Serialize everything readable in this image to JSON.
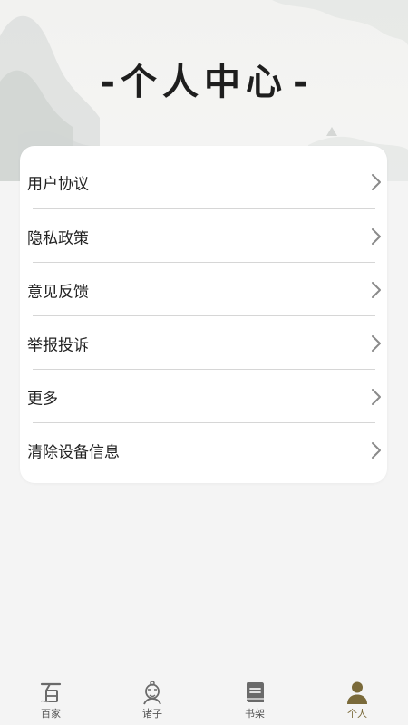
{
  "header": {
    "title": "个人中心",
    "dash_left": "-",
    "dash_right": "-"
  },
  "menu": {
    "items": [
      {
        "label": "用户协议",
        "icon": "chevron-right-icon"
      },
      {
        "label": "隐私政策",
        "icon": "chevron-right-icon"
      },
      {
        "label": "意见反馈",
        "icon": "chevron-right-icon"
      },
      {
        "label": "举报投诉",
        "icon": "chevron-right-icon"
      },
      {
        "label": "更多",
        "icon": "chevron-right-icon"
      },
      {
        "label": "清除设备信息",
        "icon": "chevron-right-icon"
      }
    ]
  },
  "tabbar": {
    "tabs": [
      {
        "label": "百家",
        "icon": "baijia-icon",
        "active": false
      },
      {
        "label": "诸子",
        "icon": "scholar-icon",
        "active": false
      },
      {
        "label": "书架",
        "icon": "book-icon",
        "active": false
      },
      {
        "label": "个人",
        "icon": "person-icon",
        "active": true
      }
    ]
  },
  "colors": {
    "background": "#f4f4f4",
    "card": "#ffffff",
    "active_tab": "#7a6a3a",
    "inactive_tab": "#555555"
  }
}
